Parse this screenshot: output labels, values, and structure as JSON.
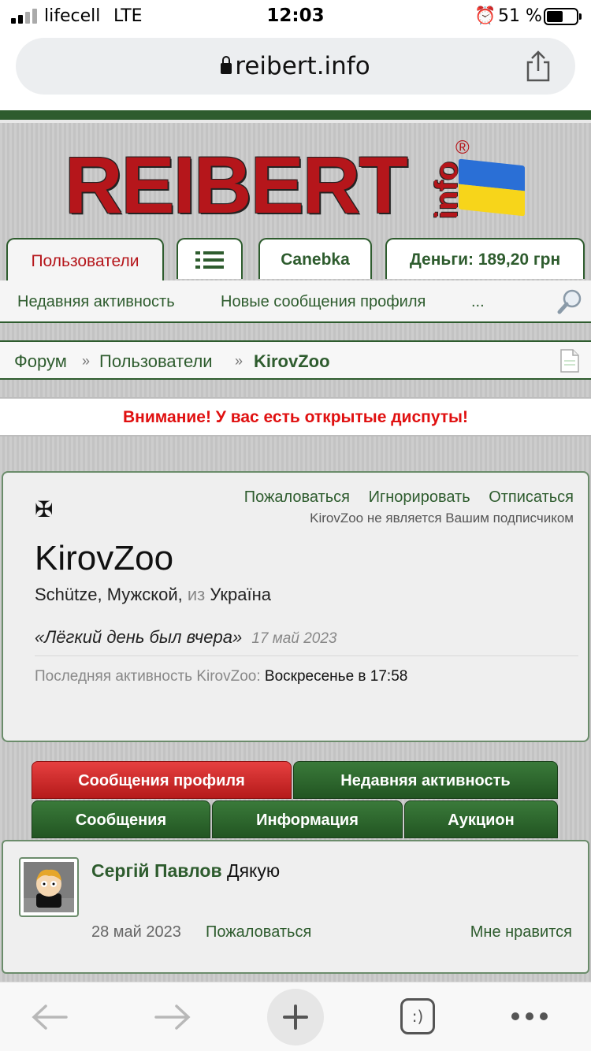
{
  "status": {
    "carrier": "lifecell",
    "network": "LTE",
    "time": "12:03",
    "battery": "51 %"
  },
  "browser": {
    "url": "reibert.info"
  },
  "site": {
    "logo_main": "REIBERT",
    "logo_sub": "info",
    "logo_reg": "®",
    "tabs": {
      "users": "Пользователи",
      "menu": "",
      "user": "Canebka",
      "money": "Деньги: 189,20 грн"
    },
    "subnav": [
      "Недавняя активность",
      "Новые сообщения профиля",
      "..."
    ],
    "breadcrumb": {
      "forum": "Форум",
      "sep": "»",
      "users": "Пользователи",
      "current": "KirovZoo"
    },
    "notice": "Внимание! У вас есть открытые диспуты!",
    "profile": {
      "actions": [
        "Пожаловаться",
        "Игнорировать",
        "Отписаться"
      ],
      "follow_note": "KirovZoo не является Вашим подписчиком",
      "icon": "✠",
      "name": "KirovZoo",
      "info_a": "Schütze, Мужской, ",
      "info_from": "из ",
      "info_b": "Україна",
      "status_quote": "«Лёгкий день был вчера»",
      "status_date": "17 май 2023",
      "last_label": "Последняя активность KirovZoo: ",
      "last_value": "Воскресенье в 17:58"
    },
    "profile_tabs": {
      "profile_posts": "Сообщения профиля",
      "recent": "Недавняя активность",
      "posts": "Сообщения",
      "info": "Информация",
      "auction": "Аукцион"
    },
    "post": {
      "author": "Сергій Павлов",
      "text": " Дякую",
      "date": "28 май 2023",
      "report": "Пожаловаться",
      "like": "Мне нравится"
    }
  },
  "colors": {
    "green": "#2e5c2e",
    "red": "#b5161b",
    "notice_red": "#e01010"
  }
}
